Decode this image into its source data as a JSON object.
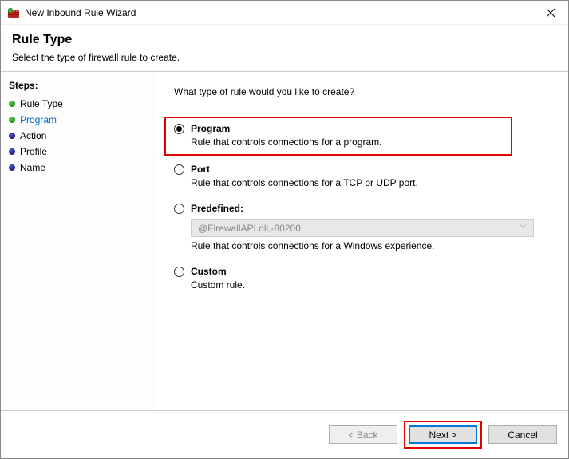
{
  "window": {
    "title": "New Inbound Rule Wizard"
  },
  "header": {
    "title": "Rule Type",
    "subtitle": "Select the type of firewall rule to create."
  },
  "sidebar": {
    "label": "Steps:",
    "items": [
      {
        "label": "Rule Type"
      },
      {
        "label": "Program"
      },
      {
        "label": "Action"
      },
      {
        "label": "Profile"
      },
      {
        "label": "Name"
      }
    ]
  },
  "main": {
    "question": "What type of rule would you like to create?",
    "options": {
      "program": {
        "label": "Program",
        "desc": "Rule that controls connections for a program."
      },
      "port": {
        "label": "Port",
        "desc": "Rule that controls connections for a TCP or UDP port."
      },
      "predefined": {
        "label": "Predefined:",
        "dropdown_value": "@FirewallAPI.dll,-80200",
        "desc": "Rule that controls connections for a Windows experience."
      },
      "custom": {
        "label": "Custom",
        "desc": "Custom rule."
      }
    }
  },
  "footer": {
    "back": "< Back",
    "next": "Next >",
    "cancel": "Cancel"
  }
}
